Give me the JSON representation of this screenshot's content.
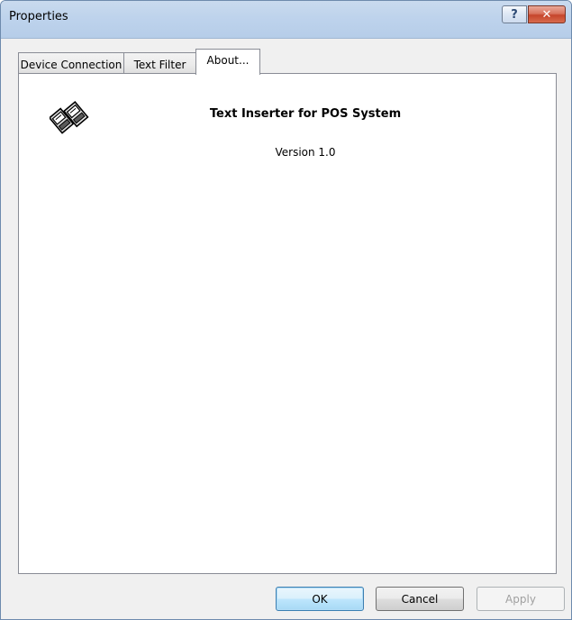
{
  "window": {
    "title": "Properties",
    "help_glyph": "?",
    "close_glyph": "✕"
  },
  "tabs": [
    {
      "label": "Device Connection",
      "active": false
    },
    {
      "label": "Text Filter",
      "active": false
    },
    {
      "label": "About...",
      "active": true
    }
  ],
  "about": {
    "icon": "printer-icon",
    "product_name": "Text Inserter for POS System",
    "version": "Version 1.0"
  },
  "buttons": {
    "ok": "OK",
    "cancel": "Cancel",
    "apply": "Apply"
  }
}
